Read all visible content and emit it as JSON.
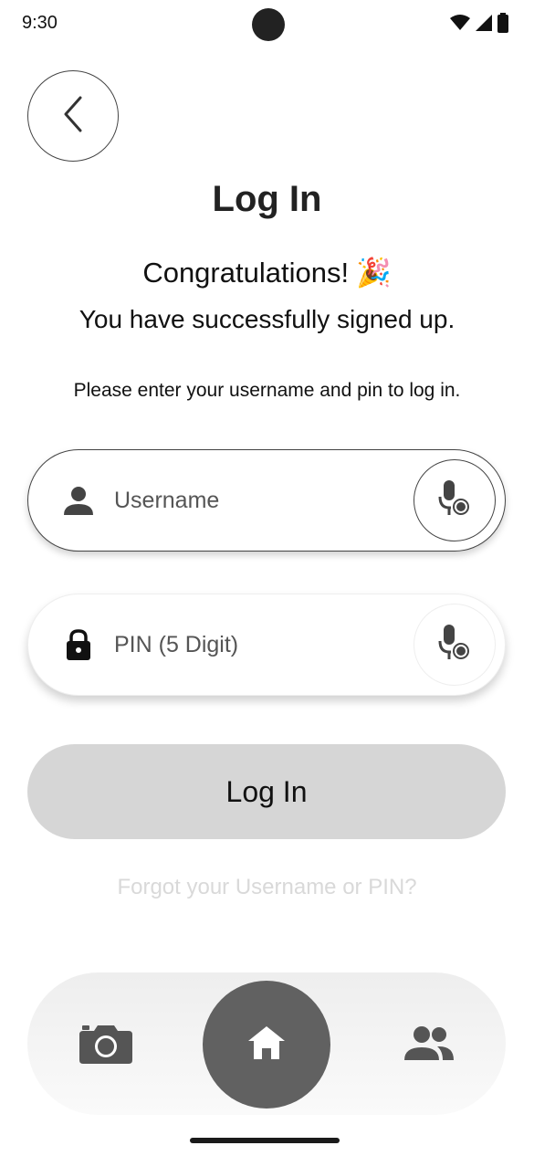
{
  "status_bar": {
    "time": "9:30"
  },
  "header": {
    "title": "Log In"
  },
  "message": {
    "congrats": "Congratulations!",
    "congrats_emoji": "🎉",
    "subtitle": "You have successfully signed up.",
    "instructions": "Please enter your username and pin to log in."
  },
  "form": {
    "username_placeholder": "Username",
    "pin_placeholder": "PIN (5 Digit)",
    "submit_label": "Log In",
    "forgot_label": "Forgot your Username or PIN?"
  },
  "bottom_nav": {
    "items": [
      {
        "icon": "camera-icon"
      },
      {
        "icon": "home-icon",
        "active": true
      },
      {
        "icon": "people-icon"
      }
    ]
  },
  "colors": {
    "button_bg": "#d6d6d6",
    "nav_active": "#616161",
    "forgot_text": "#d9d9d9"
  }
}
